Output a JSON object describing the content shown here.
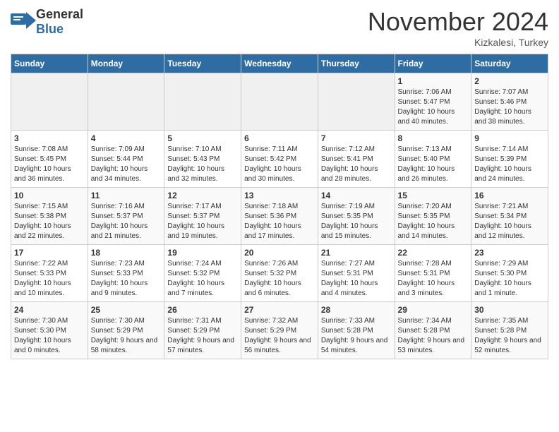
{
  "header": {
    "logo": {
      "general": "General",
      "blue": "Blue",
      "icon": "▶"
    },
    "title": "November 2024",
    "location": "Kizkalesi, Turkey"
  },
  "weekdays": [
    "Sunday",
    "Monday",
    "Tuesday",
    "Wednesday",
    "Thursday",
    "Friday",
    "Saturday"
  ],
  "weeks": [
    [
      {
        "day": "",
        "info": ""
      },
      {
        "day": "",
        "info": ""
      },
      {
        "day": "",
        "info": ""
      },
      {
        "day": "",
        "info": ""
      },
      {
        "day": "",
        "info": ""
      },
      {
        "day": "1",
        "info": "Sunrise: 7:06 AM\nSunset: 5:47 PM\nDaylight: 10 hours and 40 minutes."
      },
      {
        "day": "2",
        "info": "Sunrise: 7:07 AM\nSunset: 5:46 PM\nDaylight: 10 hours and 38 minutes."
      }
    ],
    [
      {
        "day": "3",
        "info": "Sunrise: 7:08 AM\nSunset: 5:45 PM\nDaylight: 10 hours and 36 minutes."
      },
      {
        "day": "4",
        "info": "Sunrise: 7:09 AM\nSunset: 5:44 PM\nDaylight: 10 hours and 34 minutes."
      },
      {
        "day": "5",
        "info": "Sunrise: 7:10 AM\nSunset: 5:43 PM\nDaylight: 10 hours and 32 minutes."
      },
      {
        "day": "6",
        "info": "Sunrise: 7:11 AM\nSunset: 5:42 PM\nDaylight: 10 hours and 30 minutes."
      },
      {
        "day": "7",
        "info": "Sunrise: 7:12 AM\nSunset: 5:41 PM\nDaylight: 10 hours and 28 minutes."
      },
      {
        "day": "8",
        "info": "Sunrise: 7:13 AM\nSunset: 5:40 PM\nDaylight: 10 hours and 26 minutes."
      },
      {
        "day": "9",
        "info": "Sunrise: 7:14 AM\nSunset: 5:39 PM\nDaylight: 10 hours and 24 minutes."
      }
    ],
    [
      {
        "day": "10",
        "info": "Sunrise: 7:15 AM\nSunset: 5:38 PM\nDaylight: 10 hours and 22 minutes."
      },
      {
        "day": "11",
        "info": "Sunrise: 7:16 AM\nSunset: 5:37 PM\nDaylight: 10 hours and 21 minutes."
      },
      {
        "day": "12",
        "info": "Sunrise: 7:17 AM\nSunset: 5:37 PM\nDaylight: 10 hours and 19 minutes."
      },
      {
        "day": "13",
        "info": "Sunrise: 7:18 AM\nSunset: 5:36 PM\nDaylight: 10 hours and 17 minutes."
      },
      {
        "day": "14",
        "info": "Sunrise: 7:19 AM\nSunset: 5:35 PM\nDaylight: 10 hours and 15 minutes."
      },
      {
        "day": "15",
        "info": "Sunrise: 7:20 AM\nSunset: 5:35 PM\nDaylight: 10 hours and 14 minutes."
      },
      {
        "day": "16",
        "info": "Sunrise: 7:21 AM\nSunset: 5:34 PM\nDaylight: 10 hours and 12 minutes."
      }
    ],
    [
      {
        "day": "17",
        "info": "Sunrise: 7:22 AM\nSunset: 5:33 PM\nDaylight: 10 hours and 10 minutes."
      },
      {
        "day": "18",
        "info": "Sunrise: 7:23 AM\nSunset: 5:33 PM\nDaylight: 10 hours and 9 minutes."
      },
      {
        "day": "19",
        "info": "Sunrise: 7:24 AM\nSunset: 5:32 PM\nDaylight: 10 hours and 7 minutes."
      },
      {
        "day": "20",
        "info": "Sunrise: 7:26 AM\nSunset: 5:32 PM\nDaylight: 10 hours and 6 minutes."
      },
      {
        "day": "21",
        "info": "Sunrise: 7:27 AM\nSunset: 5:31 PM\nDaylight: 10 hours and 4 minutes."
      },
      {
        "day": "22",
        "info": "Sunrise: 7:28 AM\nSunset: 5:31 PM\nDaylight: 10 hours and 3 minutes."
      },
      {
        "day": "23",
        "info": "Sunrise: 7:29 AM\nSunset: 5:30 PM\nDaylight: 10 hours and 1 minute."
      }
    ],
    [
      {
        "day": "24",
        "info": "Sunrise: 7:30 AM\nSunset: 5:30 PM\nDaylight: 10 hours and 0 minutes."
      },
      {
        "day": "25",
        "info": "Sunrise: 7:30 AM\nSunset: 5:29 PM\nDaylight: 9 hours and 58 minutes."
      },
      {
        "day": "26",
        "info": "Sunrise: 7:31 AM\nSunset: 5:29 PM\nDaylight: 9 hours and 57 minutes."
      },
      {
        "day": "27",
        "info": "Sunrise: 7:32 AM\nSunset: 5:29 PM\nDaylight: 9 hours and 56 minutes."
      },
      {
        "day": "28",
        "info": "Sunrise: 7:33 AM\nSunset: 5:28 PM\nDaylight: 9 hours and 54 minutes."
      },
      {
        "day": "29",
        "info": "Sunrise: 7:34 AM\nSunset: 5:28 PM\nDaylight: 9 hours and 53 minutes."
      },
      {
        "day": "30",
        "info": "Sunrise: 7:35 AM\nSunset: 5:28 PM\nDaylight: 9 hours and 52 minutes."
      }
    ]
  ]
}
